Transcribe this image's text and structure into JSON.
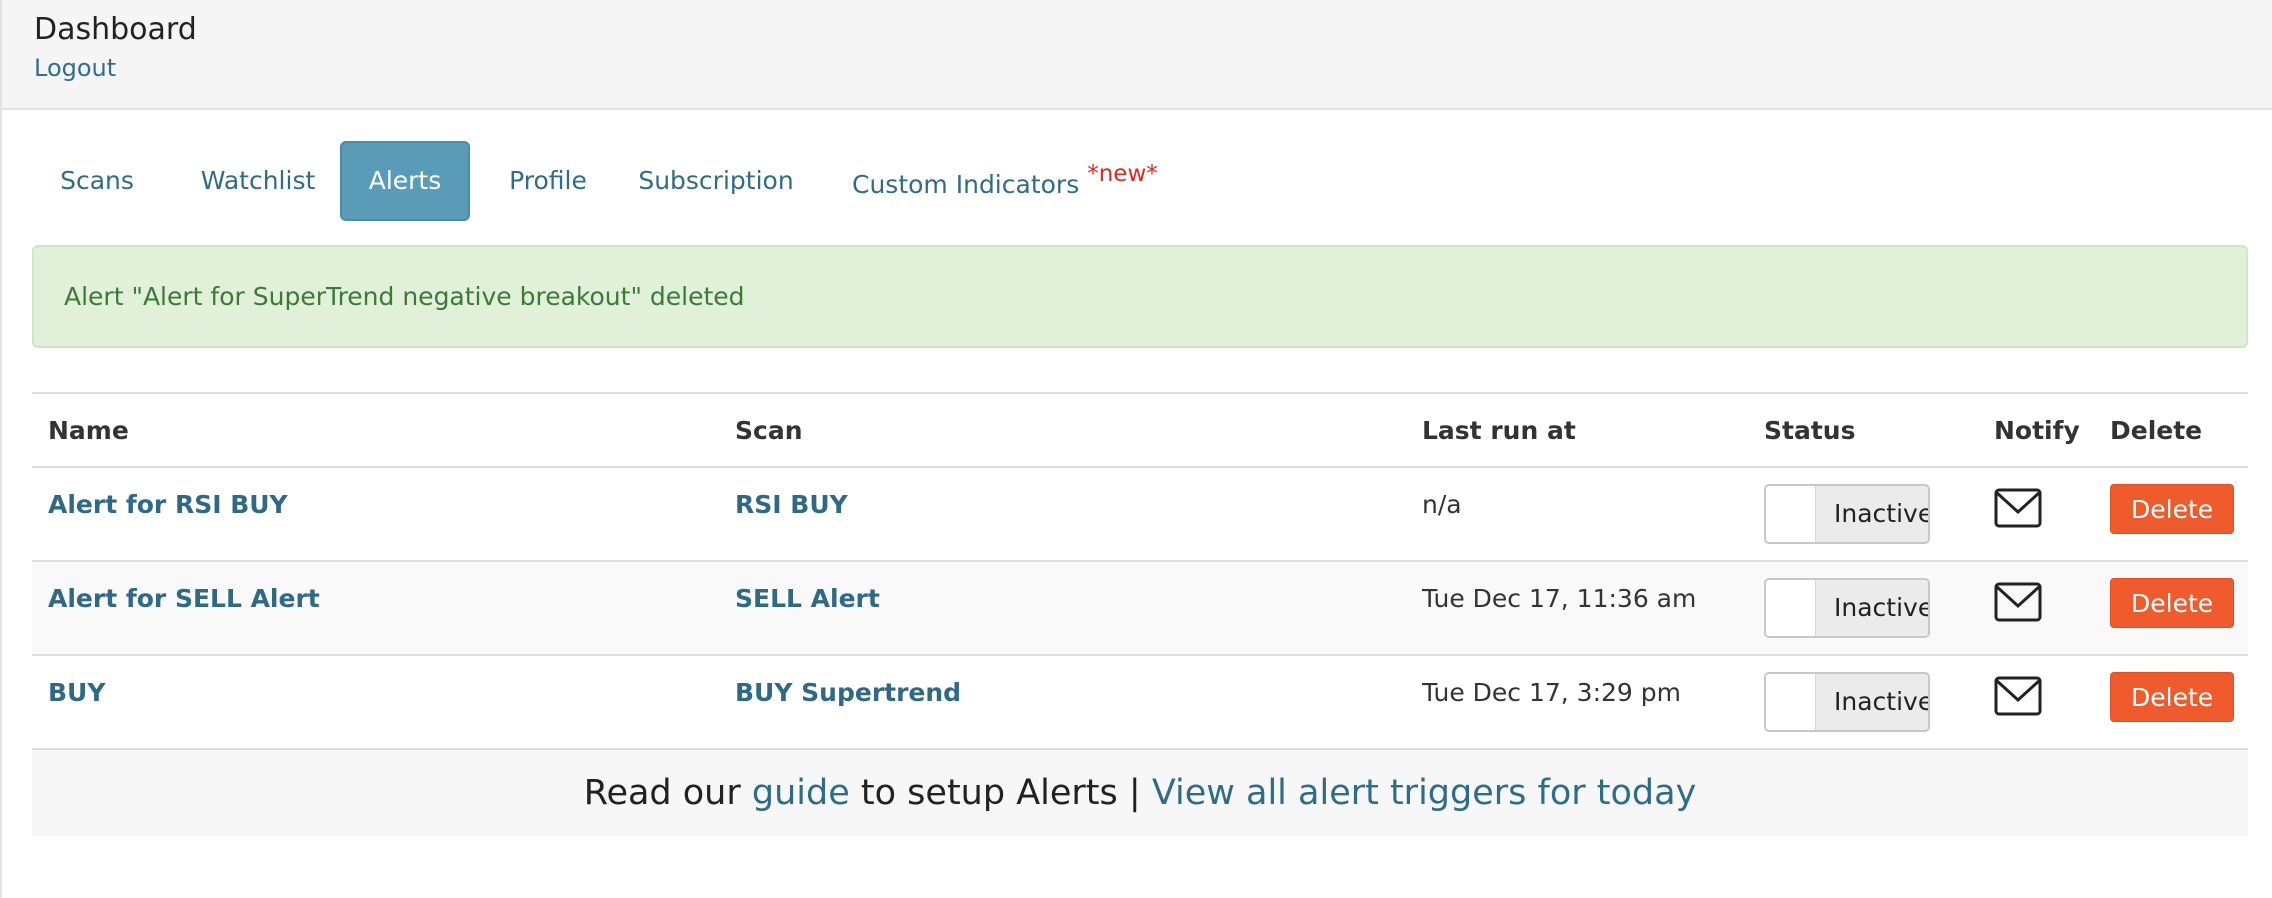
{
  "header": {
    "title": "Dashboard",
    "logout": "Logout"
  },
  "tabs": [
    {
      "label": "Scans",
      "active": false
    },
    {
      "label": "Watchlist",
      "active": false
    },
    {
      "label": "Alerts",
      "active": true
    },
    {
      "label": "Profile",
      "active": false
    },
    {
      "label": "Subscription",
      "active": false
    },
    {
      "label": "Custom Indicators",
      "badge": "*new*",
      "active": false
    }
  ],
  "flash": {
    "message": "Alert \"Alert for SuperTrend negative breakout\" deleted"
  },
  "table": {
    "columns": [
      "Name",
      "Scan",
      "Last run at",
      "Status",
      "Notify",
      "Delete"
    ],
    "rows": [
      {
        "name": "Alert for RSI BUY",
        "scan": "RSI BUY",
        "last_run": "n/a",
        "status": "Inactive",
        "notify_icon": "envelope-icon",
        "delete": "Delete"
      },
      {
        "name": "Alert for SELL Alert",
        "scan": "SELL Alert",
        "last_run": "Tue Dec 17, 11:36 am",
        "status": "Inactive",
        "notify_icon": "envelope-icon",
        "delete": "Delete"
      },
      {
        "name": "BUY",
        "scan": "BUY Supertrend",
        "last_run": "Tue Dec 17, 3:29 pm",
        "status": "Inactive",
        "notify_icon": "envelope-icon",
        "delete": "Delete"
      }
    ]
  },
  "footer": {
    "prefix": "Read our",
    "guide_link": "guide",
    "middle": "to setup Alerts |",
    "triggers_link": "View all alert triggers for today"
  },
  "colors": {
    "accent": "#5a9cb7",
    "link": "#2e6d8a",
    "success_bg": "#e1f0d8",
    "success_text": "#3c7a37",
    "delete": "#ef5b2d",
    "new_badge": "#e0261b"
  }
}
